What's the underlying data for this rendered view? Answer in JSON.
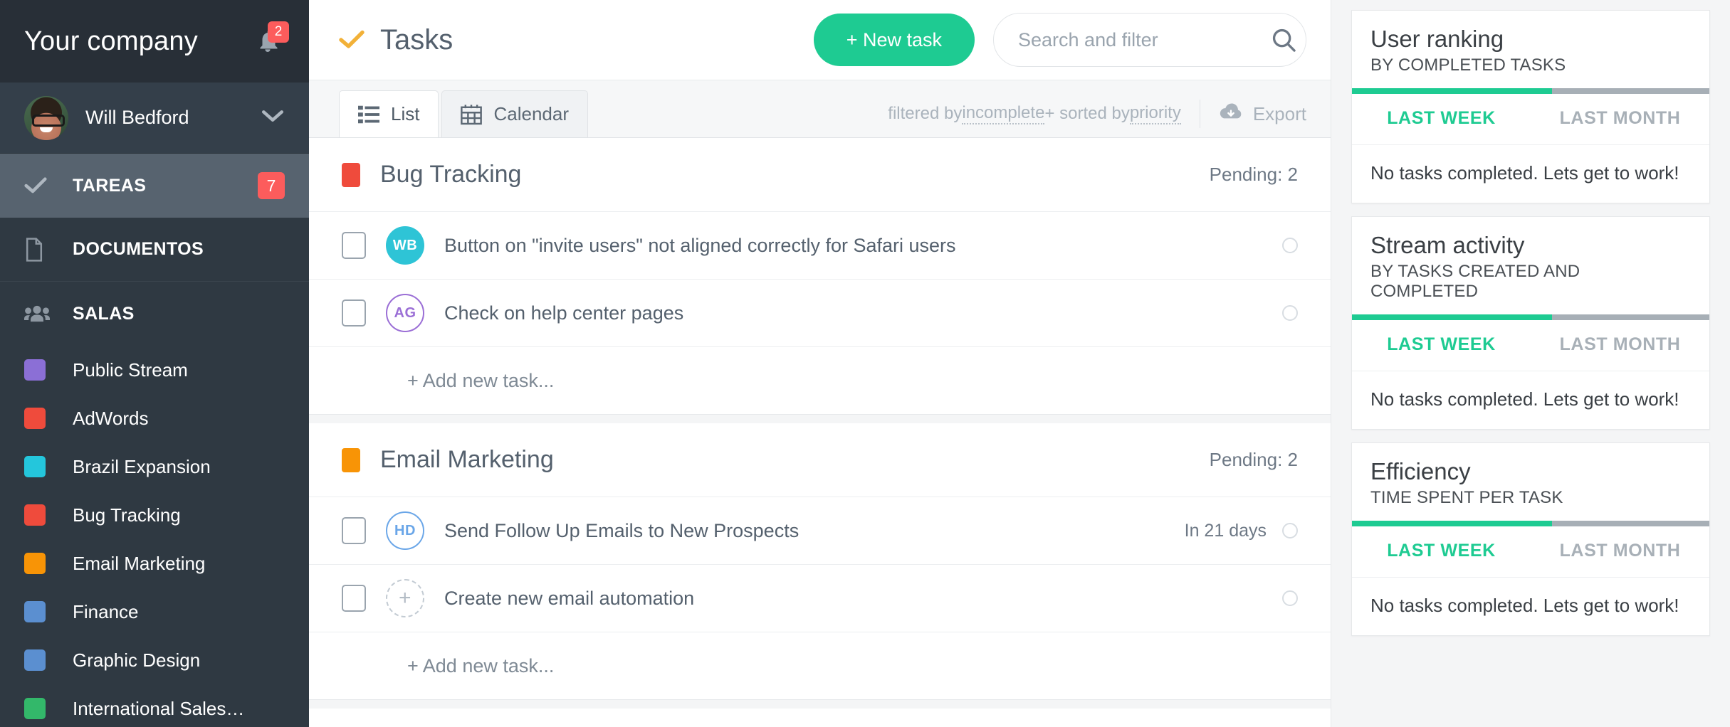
{
  "sidebar": {
    "brand": "Your company",
    "notification_count": "2",
    "user": {
      "name": "Will Bedford"
    },
    "nav": [
      {
        "label": "TAREAS",
        "icon": "check-icon",
        "badge": "7",
        "active": true
      },
      {
        "label": "DOCUMENTOS",
        "icon": "document-icon",
        "badge": "",
        "active": false
      },
      {
        "label": "SALAS",
        "icon": "people-icon",
        "badge": "",
        "active": false
      }
    ],
    "rooms": [
      {
        "label": "Public Stream",
        "color": "#8b6fd6"
      },
      {
        "label": "AdWords",
        "color": "#ef4b3c"
      },
      {
        "label": "Brazil Expansion",
        "color": "#24c6dc"
      },
      {
        "label": "Bug Tracking",
        "color": "#ef4b3c"
      },
      {
        "label": "Email Marketing",
        "color": "#f89406"
      },
      {
        "label": "Finance",
        "color": "#5b8fd0"
      },
      {
        "label": "Graphic Design",
        "color": "#5b8fd0"
      },
      {
        "label": "International Sales…",
        "color": "#33b86a"
      }
    ]
  },
  "topbar": {
    "title": "Tasks",
    "new_task_label": "+ New task",
    "search_placeholder": "Search and filter",
    "search_value": ""
  },
  "tabsbar": {
    "tabs": [
      {
        "label": "List",
        "icon": "list-icon",
        "active": true
      },
      {
        "label": "Calendar",
        "icon": "calendar-icon",
        "active": false
      }
    ],
    "filter_prefix": "filtered by ",
    "filter_link": "incomplete",
    "filter_middle": " + sorted by ",
    "sort_link": "priority",
    "export_label": "Export"
  },
  "groups": [
    {
      "name": "Bug Tracking",
      "color": "#ef4b3c",
      "pending_label": "Pending: 2",
      "add_label": "+ Add new task...",
      "tasks": [
        {
          "title": "Button on \"invite users\" not aligned correctly for Safari users",
          "initials": "WB",
          "avatar_style": "filled",
          "due": ""
        },
        {
          "title": "Check on help center pages",
          "initials": "AG",
          "avatar_style": "outline-purple",
          "due": ""
        }
      ]
    },
    {
      "name": "Email Marketing",
      "color": "#f89406",
      "pending_label": "Pending: 2",
      "add_label": "+ Add new task...",
      "tasks": [
        {
          "title": "Send Follow Up Emails to New Prospects",
          "initials": "HD",
          "avatar_style": "outline-blue",
          "due": "In 21 days"
        },
        {
          "title": "Create new email automation",
          "initials": "+",
          "avatar_style": "dashed",
          "due": ""
        }
      ]
    }
  ],
  "widgets": [
    {
      "title": "User ranking",
      "subtitle": "BY COMPLETED TASKS",
      "tab_active": "LAST WEEK",
      "tab_inactive": "LAST MONTH",
      "body": "No tasks completed. Lets get to work!"
    },
    {
      "title": "Stream activity",
      "subtitle": "BY TASKS CREATED AND COMPLETED",
      "tab_active": "LAST WEEK",
      "tab_inactive": "LAST MONTH",
      "body": "No tasks completed. Lets get to work!"
    },
    {
      "title": "Efficiency",
      "subtitle": "TIME SPENT PER TASK",
      "tab_active": "LAST WEEK",
      "tab_inactive": "LAST MONTH",
      "body": "No tasks completed. Lets get to work!"
    }
  ],
  "colors": {
    "accent_green": "#1ecb92",
    "badge_red": "#fc5c5c",
    "sidebar_bg": "#2f3942",
    "title_yellow": "#f2b138"
  }
}
